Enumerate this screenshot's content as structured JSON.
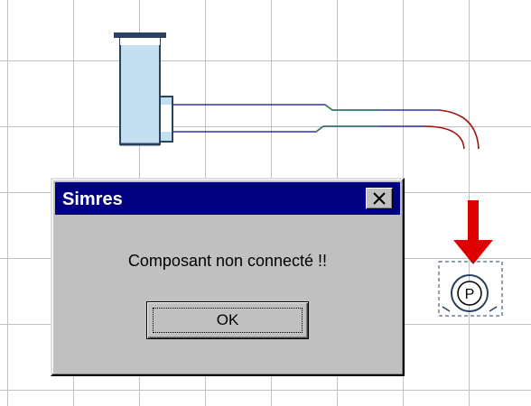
{
  "dialog": {
    "title": "Simres",
    "message": "Composant non connecté !!",
    "ok_label": "OK"
  },
  "pump": {
    "label": "P"
  },
  "icons": {
    "close": "close-icon",
    "tank": "tank-icon",
    "pump": "pump-icon",
    "arrow": "arrow-down-icon"
  },
  "colors": {
    "titlebar": "#000080",
    "dialog_face": "#c0c0c0",
    "tank_fill": "#c4dff0",
    "tank_outline": "#2a4160",
    "pipe": "#3030b0",
    "pipe_mid": "#3a7a6a",
    "pipe_bend": "#a01010",
    "arrow": "#e00000",
    "grid": "#c0c0c0"
  }
}
